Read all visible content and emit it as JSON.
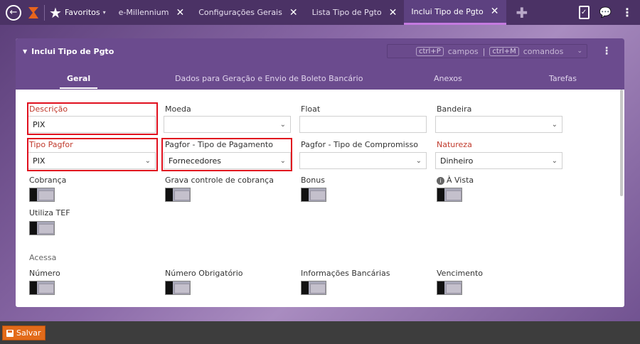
{
  "topbar": {
    "favorites_label": "Favoritos",
    "tabs": [
      {
        "label": "e-Millennium"
      },
      {
        "label": "Configurações Gerais"
      },
      {
        "label": "Lista Tipo de Pgto"
      },
      {
        "label": "Inclui Tipo de Pgto"
      }
    ],
    "close_glyph": "✕",
    "plus_glyph": "✚"
  },
  "panel": {
    "title": "Inclui Tipo de Pgto",
    "shortcut_1_key": "ctrl+P",
    "shortcut_1_label": "campos",
    "shortcut_sep": "|",
    "shortcut_2_key": "ctrl+M",
    "shortcut_2_label": "comandos",
    "subtabs": [
      {
        "label": "Geral"
      },
      {
        "label": "Dados para Geração e Envio de Boleto Bancário"
      },
      {
        "label": "Anexos"
      },
      {
        "label": "Tarefas"
      }
    ]
  },
  "form": {
    "descricao": {
      "label": "Descrição",
      "value": "PIX"
    },
    "moeda": {
      "label": "Moeda",
      "value": ""
    },
    "float": {
      "label": "Float",
      "value": ""
    },
    "bandeira": {
      "label": "Bandeira",
      "value": ""
    },
    "tipo_pagfor": {
      "label": "Tipo Pagfor",
      "value": "PIX"
    },
    "pagfor_tipo_pagamento": {
      "label": "Pagfor - Tipo de Pagamento",
      "value": "Fornecedores"
    },
    "pagfor_tipo_compromisso": {
      "label": "Pagfor - Tipo de Compromisso",
      "value": ""
    },
    "natureza": {
      "label": "Natureza",
      "value": "Dinheiro"
    },
    "cobranca": {
      "label": "Cobrança"
    },
    "grava_controle": {
      "label": "Grava controle de cobrança"
    },
    "bonus": {
      "label": "Bonus"
    },
    "a_vista": {
      "label": "À Vista"
    },
    "utiliza_tef": {
      "label": "Utiliza TEF"
    },
    "section_acessa": "Acessa",
    "numero": {
      "label": "Número"
    },
    "numero_obrigatorio": {
      "label": "Número Obrigatório"
    },
    "informacoes_bancarias": {
      "label": "Informações Bancárias"
    },
    "vencimento": {
      "label": "Vencimento"
    }
  },
  "footer": {
    "save_label": "Salvar"
  },
  "colors": {
    "topbar": "#4b3265",
    "panel_header": "#6b4b8e",
    "required_label": "#c0392b",
    "highlight_box": "#e0101e",
    "save_button": "#e36b1a"
  }
}
